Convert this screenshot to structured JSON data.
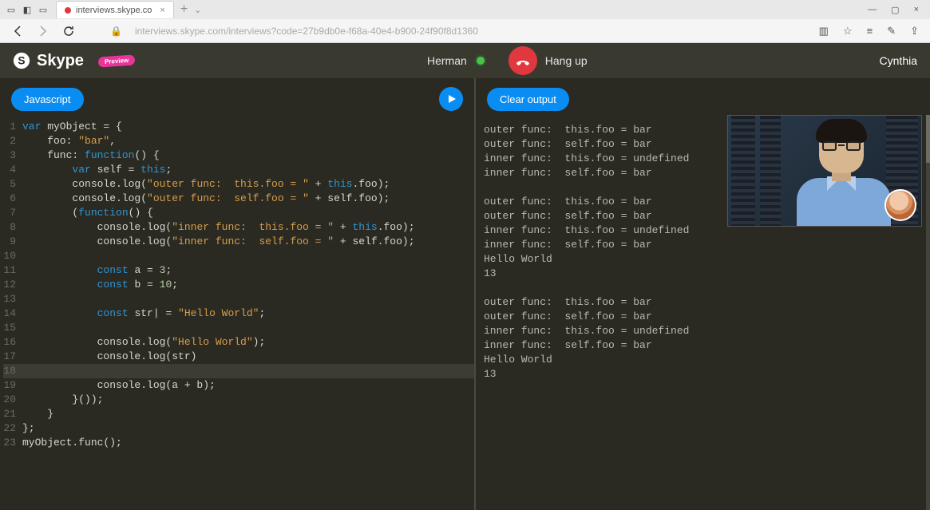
{
  "browser": {
    "tab_title": "interviews.skype.co",
    "url": "interviews.skype.com/interviews?code=27b9db0e-f68a-40e4-b900-24f90f8d1360"
  },
  "header": {
    "product": "Skype",
    "badge": "Preview",
    "caller": "Herman",
    "hangup_label": "Hang up",
    "remote_user": "Cynthia"
  },
  "editor": {
    "lang_label": "Javascript",
    "lines": [
      {
        "n": 1,
        "html": "<span class='kw'>var</span> myObject = {"
      },
      {
        "n": 2,
        "html": "    foo: <span class='str'>\"bar\"</span>,"
      },
      {
        "n": 3,
        "html": "    func: <span class='kw'>function</span>() {"
      },
      {
        "n": 4,
        "html": "        <span class='kw'>var</span> self = <span class='this'>this</span>;"
      },
      {
        "n": 5,
        "html": "        console.log(<span class='str'>\"outer func:  this.foo = \"</span> + <span class='this'>this</span>.foo);"
      },
      {
        "n": 6,
        "html": "        console.log(<span class='str'>\"outer func:  self.foo = \"</span> + self.foo);"
      },
      {
        "n": 7,
        "html": "        (<span class='kw'>function</span>() {"
      },
      {
        "n": 8,
        "html": "            console.log(<span class='str'>\"inner func:  this.foo = \"</span> + <span class='this'>this</span>.foo);"
      },
      {
        "n": 9,
        "html": "            console.log(<span class='str'>\"inner func:  self.foo = \"</span> + self.foo);"
      },
      {
        "n": 10,
        "html": ""
      },
      {
        "n": 11,
        "html": "            <span class='kw'>const</span> a = <span class='num'>3</span>;"
      },
      {
        "n": 12,
        "html": "            <span class='kw'>const</span> b = <span class='num'>10</span>;"
      },
      {
        "n": 13,
        "html": ""
      },
      {
        "n": 14,
        "html": "            <span class='kw'>const</span> str| = <span class='str'>\"Hello World\"</span>;"
      },
      {
        "n": 15,
        "html": ""
      },
      {
        "n": 16,
        "html": "            console.log(<span class='str'>\"Hello World\"</span>);"
      },
      {
        "n": 17,
        "html": "            console.log(str)"
      },
      {
        "n": 18,
        "html": "",
        "hl": true
      },
      {
        "n": 19,
        "html": "            console.log(a + b);"
      },
      {
        "n": 20,
        "html": "        }());"
      },
      {
        "n": 21,
        "html": "    }"
      },
      {
        "n": 22,
        "html": "};"
      },
      {
        "n": 23,
        "html": "myObject.func();"
      }
    ]
  },
  "output": {
    "clear_label": "Clear output",
    "text": "outer func:  this.foo = bar\nouter func:  self.foo = bar\ninner func:  this.foo = undefined\ninner func:  self.foo = bar\n\nouter func:  this.foo = bar\nouter func:  self.foo = bar\ninner func:  this.foo = undefined\ninner func:  self.foo = bar\nHello World\n13\n\nouter func:  this.foo = bar\nouter func:  self.foo = bar\ninner func:  this.foo = undefined\ninner func:  self.foo = bar\nHello World\n13"
  }
}
